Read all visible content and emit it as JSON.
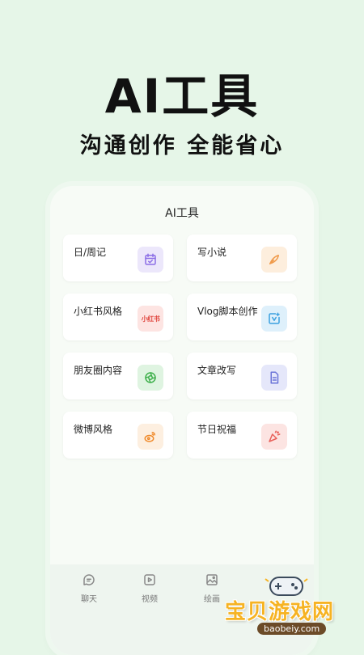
{
  "hero": {
    "title": "AI工具",
    "subtitle": "沟通创作 全能省心"
  },
  "phone": {
    "header_title": "AI工具",
    "tools": [
      {
        "label": "日/周记",
        "icon": "calendar-check-icon",
        "color": "#8b6fe6",
        "bg": "#ece7fb"
      },
      {
        "label": "写小说",
        "icon": "quill-pen-icon",
        "color": "#f09a4a",
        "bg": "#fdeedd"
      },
      {
        "label": "小红书风格",
        "icon": "xiaohongshu-icon",
        "icon_text": "小红书",
        "color": "#e0463f",
        "bg": "#fde4e2"
      },
      {
        "label": "Vlog脚本创作",
        "icon": "video-script-icon",
        "color": "#3aa0e0",
        "bg": "#def0fb"
      },
      {
        "label": "朋友圈内容",
        "icon": "aperture-icon",
        "color": "#3fb04c",
        "bg": "#dff4e1"
      },
      {
        "label": "文章改写",
        "icon": "document-icon",
        "color": "#6b74d8",
        "bg": "#e5e7fa"
      },
      {
        "label": "微博风格",
        "icon": "weibo-icon",
        "color": "#f08a2a",
        "bg": "#fdefe0"
      },
      {
        "label": "节日祝福",
        "icon": "party-popper-icon",
        "color": "#e8605a",
        "bg": "#fce4e2"
      }
    ],
    "tabs": [
      {
        "label": "聊天",
        "icon": "chat-icon"
      },
      {
        "label": "视频",
        "icon": "video-icon"
      },
      {
        "label": "绘画",
        "icon": "image-icon"
      }
    ]
  },
  "watermark": {
    "text": "宝贝游戏网",
    "url": "baobeiy.com"
  }
}
